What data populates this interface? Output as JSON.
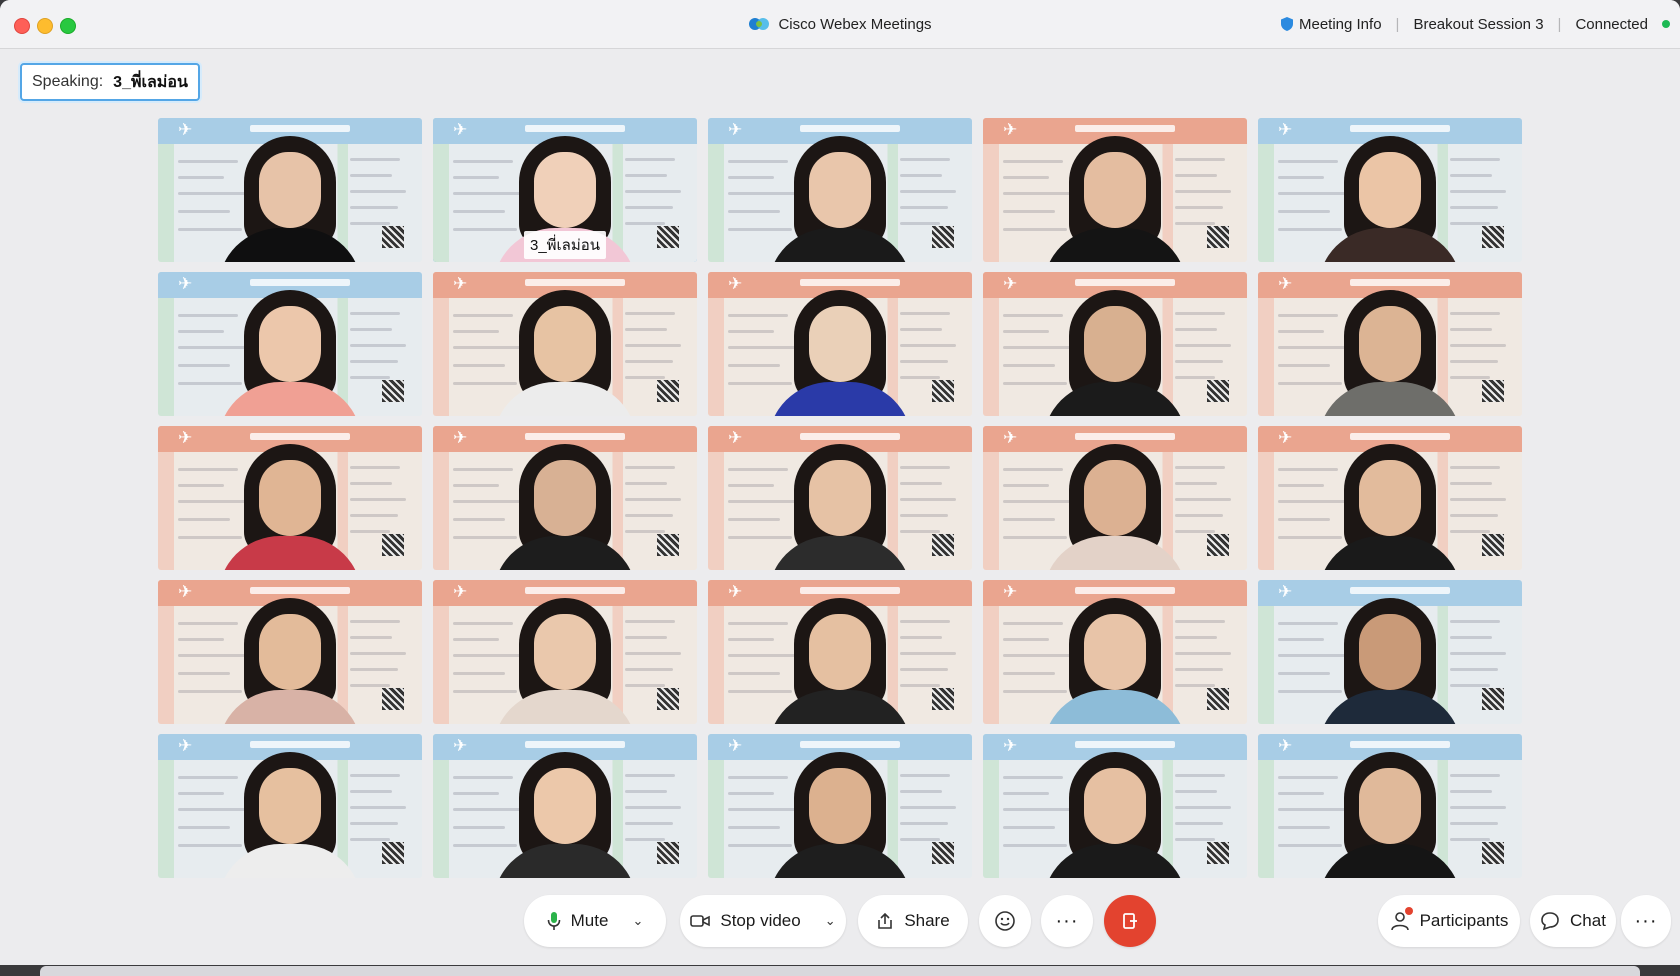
{
  "app": {
    "title": "Cisco Webex Meetings",
    "meeting_info": "Meeting Info",
    "session": "Breakout Session 3",
    "status": "Connected",
    "status_color": "#1db954"
  },
  "speaking": {
    "label": "Speaking:",
    "name": "3_พี่เลม่อน"
  },
  "participants": [
    {
      "theme": "blue",
      "top_color": "#0f0f10",
      "skin": "#e7c3a8"
    },
    {
      "theme": "blue",
      "top_color": "#f2c7d6",
      "skin": "#f0d0b9",
      "name": "3_พี่เลม่อน",
      "active": true
    },
    {
      "theme": "blue",
      "top_color": "#1a1a1a",
      "skin": "#e9c6ab"
    },
    {
      "theme": "peach",
      "top_color": "#141414",
      "skin": "#e4bda0"
    },
    {
      "theme": "blue",
      "top_color": "#3a2a26",
      "skin": "#ebc5a6"
    },
    {
      "theme": "blue",
      "top_color": "#f0a094",
      "skin": "#ecc7ab"
    },
    {
      "theme": "peach",
      "top_color": "#ececec",
      "skin": "#e7c3a3"
    },
    {
      "theme": "peach",
      "top_color": "#2a3aa8",
      "skin": "#ead0b8"
    },
    {
      "theme": "peach",
      "top_color": "#1b1b1b",
      "skin": "#d8b090"
    },
    {
      "theme": "peach",
      "top_color": "#6e6e6a",
      "skin": "#dcb494"
    },
    {
      "theme": "peach",
      "top_color": "#c83a48",
      "skin": "#e0b594"
    },
    {
      "theme": "peach",
      "top_color": "#1d1d1d",
      "skin": "#d8b194"
    },
    {
      "theme": "peach",
      "top_color": "#2c2c2c",
      "skin": "#e6c2a5"
    },
    {
      "theme": "peach",
      "top_color": "#e3d2c8",
      "skin": "#dcb192"
    },
    {
      "theme": "peach",
      "top_color": "#1a1a1a",
      "skin": "#e2bb9c"
    },
    {
      "theme": "peach",
      "top_color": "#d8b2a6",
      "skin": "#e3bb9a"
    },
    {
      "theme": "peach",
      "top_color": "#e4d7cd",
      "skin": "#eac8ac"
    },
    {
      "theme": "peach",
      "top_color": "#222222",
      "skin": "#e5c0a1"
    },
    {
      "theme": "peach",
      "top_color": "#8dbcd8",
      "skin": "#e8c4a8"
    },
    {
      "theme": "blue",
      "top_color": "#1e2a3a",
      "skin": "#c99a78"
    },
    {
      "theme": "blue",
      "top_color": "#ededed",
      "skin": "#e6c09f"
    },
    {
      "theme": "blue",
      "top_color": "#2a2a2a",
      "skin": "#ecc8aa"
    },
    {
      "theme": "blue",
      "top_color": "#1e1e1e",
      "skin": "#dcb18f"
    },
    {
      "theme": "blue",
      "top_color": "#1a1a1a",
      "skin": "#e6c0a2"
    },
    {
      "theme": "blue",
      "top_color": "#151515",
      "skin": "#e0b99a"
    }
  ],
  "themes": {
    "blue": {
      "band": "#a8cde6",
      "card": "#e7ecef",
      "stripe": "#cfe5d6"
    },
    "peach": {
      "band": "#eaa58f",
      "card": "#f0e9e2",
      "stripe": "#f1cfc2"
    }
  },
  "controls": {
    "mute": "Mute",
    "stop_video": "Stop video",
    "share": "Share",
    "participants": "Participants",
    "chat": "Chat"
  },
  "icons": {
    "mic": "microphone-icon",
    "video": "video-camera-icon",
    "share": "share-upload-icon",
    "reactions": "smiley-icon",
    "more": "more-icon",
    "leave": "leave-door-icon",
    "participants": "person-icon",
    "chat": "chat-bubble-icon"
  }
}
